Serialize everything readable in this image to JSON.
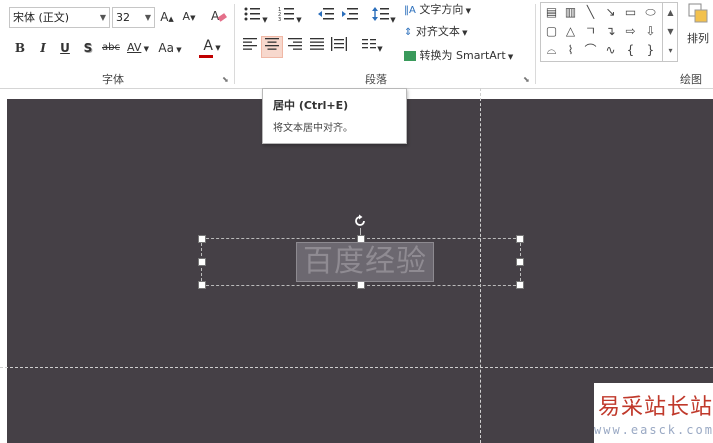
{
  "ribbon": {
    "font_group": {
      "font_name": "宋体 (正文)",
      "font_size": "32",
      "grow_font": "A",
      "shrink_font": "A",
      "bold": "B",
      "italic": "I",
      "underline": "U",
      "shadow": "S",
      "strikethrough": "abc",
      "char_spacing": "AV",
      "change_case": "Aa",
      "font_color": "A",
      "group_label": "字体"
    },
    "paragraph_group": {
      "text_direction": "文字方向",
      "align_text": "对齐文本",
      "convert_smartart": "转换为 SmartArt",
      "group_label": "段落"
    },
    "drawing_group": {
      "arrange": "排列",
      "group_label": "绘图"
    }
  },
  "tooltip": {
    "title": "居中 (Ctrl+E)",
    "description": "将文本居中对齐。"
  },
  "slide": {
    "textbox_text": "百度经验"
  },
  "watermark": {
    "main": "易采站长站",
    "sub": "www.easck.com"
  },
  "colors": {
    "slide_bg": "#454046",
    "font_color_bar": "#c00000",
    "active_button": "#f7d8cd",
    "watermark_red": "#c0392b"
  }
}
